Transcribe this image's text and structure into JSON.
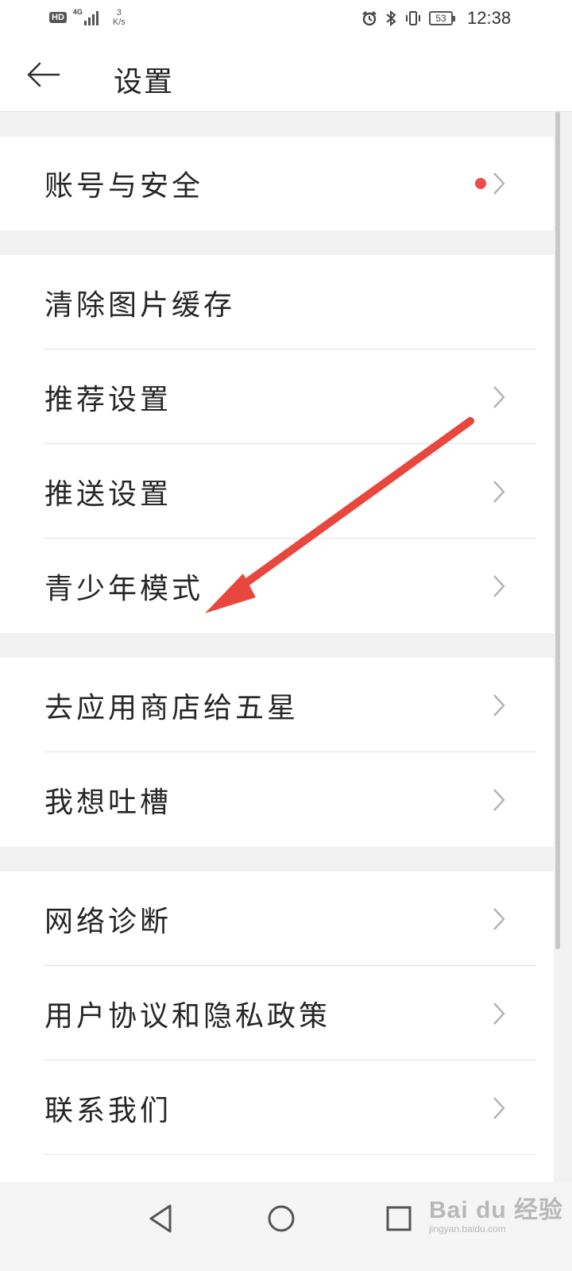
{
  "status_bar": {
    "hd_badge": "HD",
    "network": "4G",
    "speed_value": "3",
    "speed_unit": "K/s",
    "battery": "53",
    "time": "12:38",
    "icons": [
      "alarm-icon",
      "bluetooth-icon",
      "vibrate-icon",
      "battery-icon"
    ]
  },
  "header": {
    "title": "设置",
    "back_icon": "back-arrow-icon"
  },
  "sections": [
    {
      "items": [
        {
          "label": "账号与安全",
          "has_chevron": true,
          "badge_color": "#f04a4a"
        }
      ]
    },
    {
      "items": [
        {
          "label": "清除图片缓存",
          "has_chevron": false
        },
        {
          "label": "推荐设置",
          "has_chevron": true
        },
        {
          "label": "推送设置",
          "has_chevron": true
        },
        {
          "label": "青少年模式",
          "has_chevron": true
        }
      ]
    },
    {
      "items": [
        {
          "label": "去应用商店给五星",
          "has_chevron": true
        },
        {
          "label": "我想吐槽",
          "has_chevron": true
        }
      ]
    },
    {
      "items": [
        {
          "label": "网络诊断",
          "has_chevron": true
        },
        {
          "label": "用户协议和隐私政策",
          "has_chevron": true
        },
        {
          "label": "联系我们",
          "has_chevron": true
        }
      ]
    }
  ],
  "nav_bar": {
    "icons": [
      "back-triangle-icon",
      "home-circle-icon",
      "recents-square-icon"
    ]
  },
  "annotation": {
    "type": "red-arrow",
    "color": "#e8473d",
    "points_to": "青少年模式"
  },
  "watermark": {
    "text": "Bai du 经验",
    "sub": "jingyan.baidu.com"
  }
}
